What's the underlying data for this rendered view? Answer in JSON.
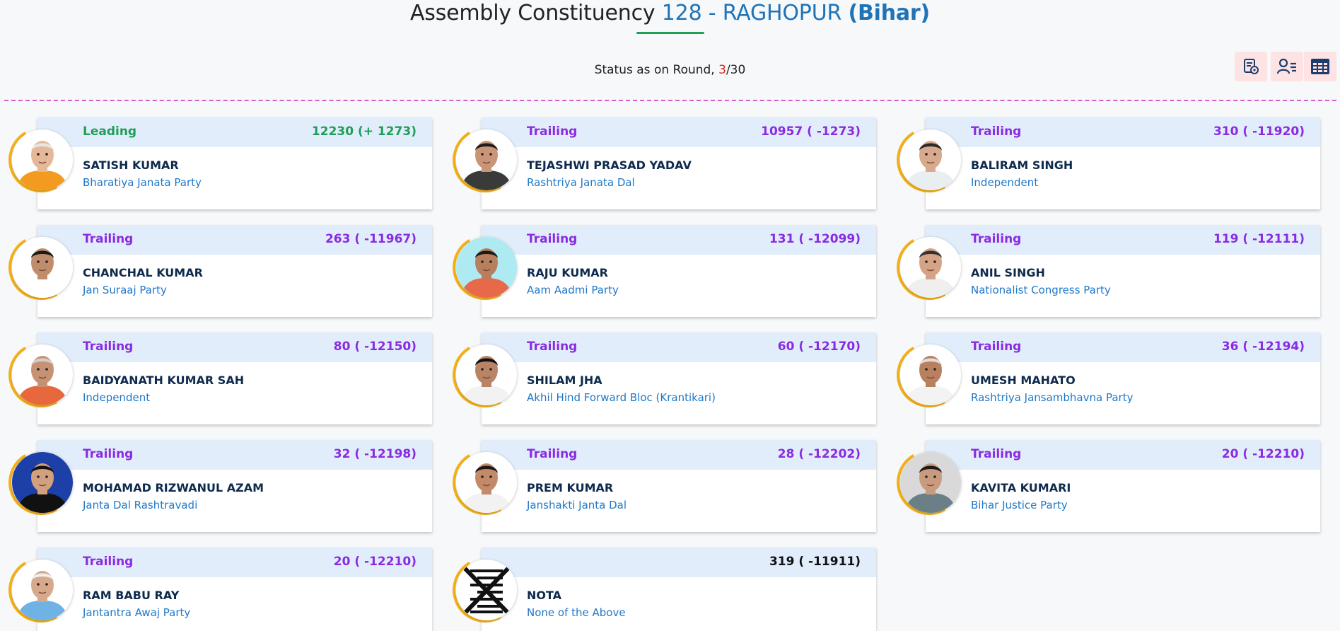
{
  "header": {
    "title_prefix": "Assembly Constituency",
    "title_number": "128 - RAGHOPUR",
    "title_state": "(Bihar)",
    "status_prefix": "Status as on Round,",
    "round_current": "3",
    "round_total": "/30"
  },
  "toolbar": {
    "icons": [
      "results-settings-icon",
      "user-list-icon",
      "table-grid-icon"
    ]
  },
  "colors": {
    "leading": "#1e9e57",
    "trailing": "#8a2be2",
    "accent": "#1f73b7",
    "ring": "#f7b319",
    "header_band": "#e1edfb"
  },
  "candidates": [
    {
      "status": "Leading",
      "votes": "12230 (+ 1273)",
      "name": "SATISH KUMAR",
      "party": "Bharatiya Janata Party",
      "skin": "#e6b89a",
      "shirt": "#f39a21",
      "bg": "#ffffff",
      "hair": "#e8e6e2"
    },
    {
      "status": "Trailing",
      "votes": "10957 ( -1273)",
      "name": "TEJASHWI PRASAD YADAV",
      "party": "Rashtriya Janata Dal",
      "skin": "#c99576",
      "shirt": "#3a3a3a",
      "bg": "#ffffff",
      "hair": "#1d1d1d"
    },
    {
      "status": "Trailing",
      "votes": "310 ( -11920)",
      "name": "BALIRAM SINGH",
      "party": "Independent",
      "skin": "#d8a98c",
      "shirt": "#e9eef0",
      "bg": "#ffffff",
      "hair": "#2a2a2a"
    },
    {
      "status": "Trailing",
      "votes": "263 ( -11967)",
      "name": "CHANCHAL KUMAR",
      "party": "Jan Suraaj Party",
      "skin": "#c08d6c",
      "shirt": "#ffffff",
      "bg": "#ffffff",
      "hair": "#1a1a1a"
    },
    {
      "status": "Trailing",
      "votes": "131 ( -12099)",
      "name": "RAJU KUMAR",
      "party": "Aam Aadmi Party",
      "skin": "#b77f5d",
      "shirt": "#e8684a",
      "bg": "#aeeaf1",
      "hair": "#1a1a1a"
    },
    {
      "status": "Trailing",
      "votes": "119 ( -12111)",
      "name": "ANIL SINGH",
      "party": "Nationalist Congress Party",
      "skin": "#d5a486",
      "shirt": "#efefef",
      "bg": "#ffffff",
      "hair": "#333333"
    },
    {
      "status": "Trailing",
      "votes": "80 ( -12150)",
      "name": "BAIDYANATH KUMAR SAH",
      "party": "Independent",
      "skin": "#c79273",
      "shirt": "#e7683c",
      "bg": "#ffffff",
      "hair": "#cfcfcf"
    },
    {
      "status": "Trailing",
      "votes": "60 ( -12170)",
      "name": "SHILAM JHA",
      "party": "Akhil Hind Forward Bloc (Krantikari)",
      "skin": "#b98466",
      "shirt": "#f2f2f2",
      "bg": "#ffffff",
      "hair": "#111111"
    },
    {
      "status": "Trailing",
      "votes": "36 ( -12194)",
      "name": "UMESH MAHATO",
      "party": "Rashtriya Jansambhavna Party",
      "skin": "#b8805f",
      "shirt": "#f3f3f3",
      "bg": "#ffffff",
      "hair": "#dddddd"
    },
    {
      "status": "Trailing",
      "votes": "32 ( -12198)",
      "name": "MOHAMAD RIZWANUL AZAM",
      "party": "Janta Dal Rashtravadi",
      "skin": "#d2a07f",
      "shirt": "#111111",
      "bg": "#1c3fa8",
      "hair": "#111111"
    },
    {
      "status": "Trailing",
      "votes": "28 ( -12202)",
      "name": "PREM KUMAR",
      "party": "Janshakti Janta Dal",
      "skin": "#c28a69",
      "shirt": "#f2f2f2",
      "bg": "#ffffff",
      "hair": "#1a1a1a"
    },
    {
      "status": "Trailing",
      "votes": "20 ( -12210)",
      "name": "KAVITA KUMARI",
      "party": "Bihar Justice Party",
      "skin": "#c99b7e",
      "shirt": "#6b7f86",
      "bg": "#d9d9d9",
      "hair": "#1a1a1a"
    },
    {
      "status": "Trailing",
      "votes": "20 ( -12210)",
      "name": "RAM BABU RAY",
      "party": "Jantantra Awaj Party",
      "skin": "#d7a98c",
      "shirt": "#6fb2e6",
      "bg": "#ffffff",
      "hair": "#eeeeee"
    },
    {
      "status": "",
      "votes": "319 ( -11911)",
      "name": "NOTA",
      "party": "None of the Above",
      "nota": true
    }
  ]
}
